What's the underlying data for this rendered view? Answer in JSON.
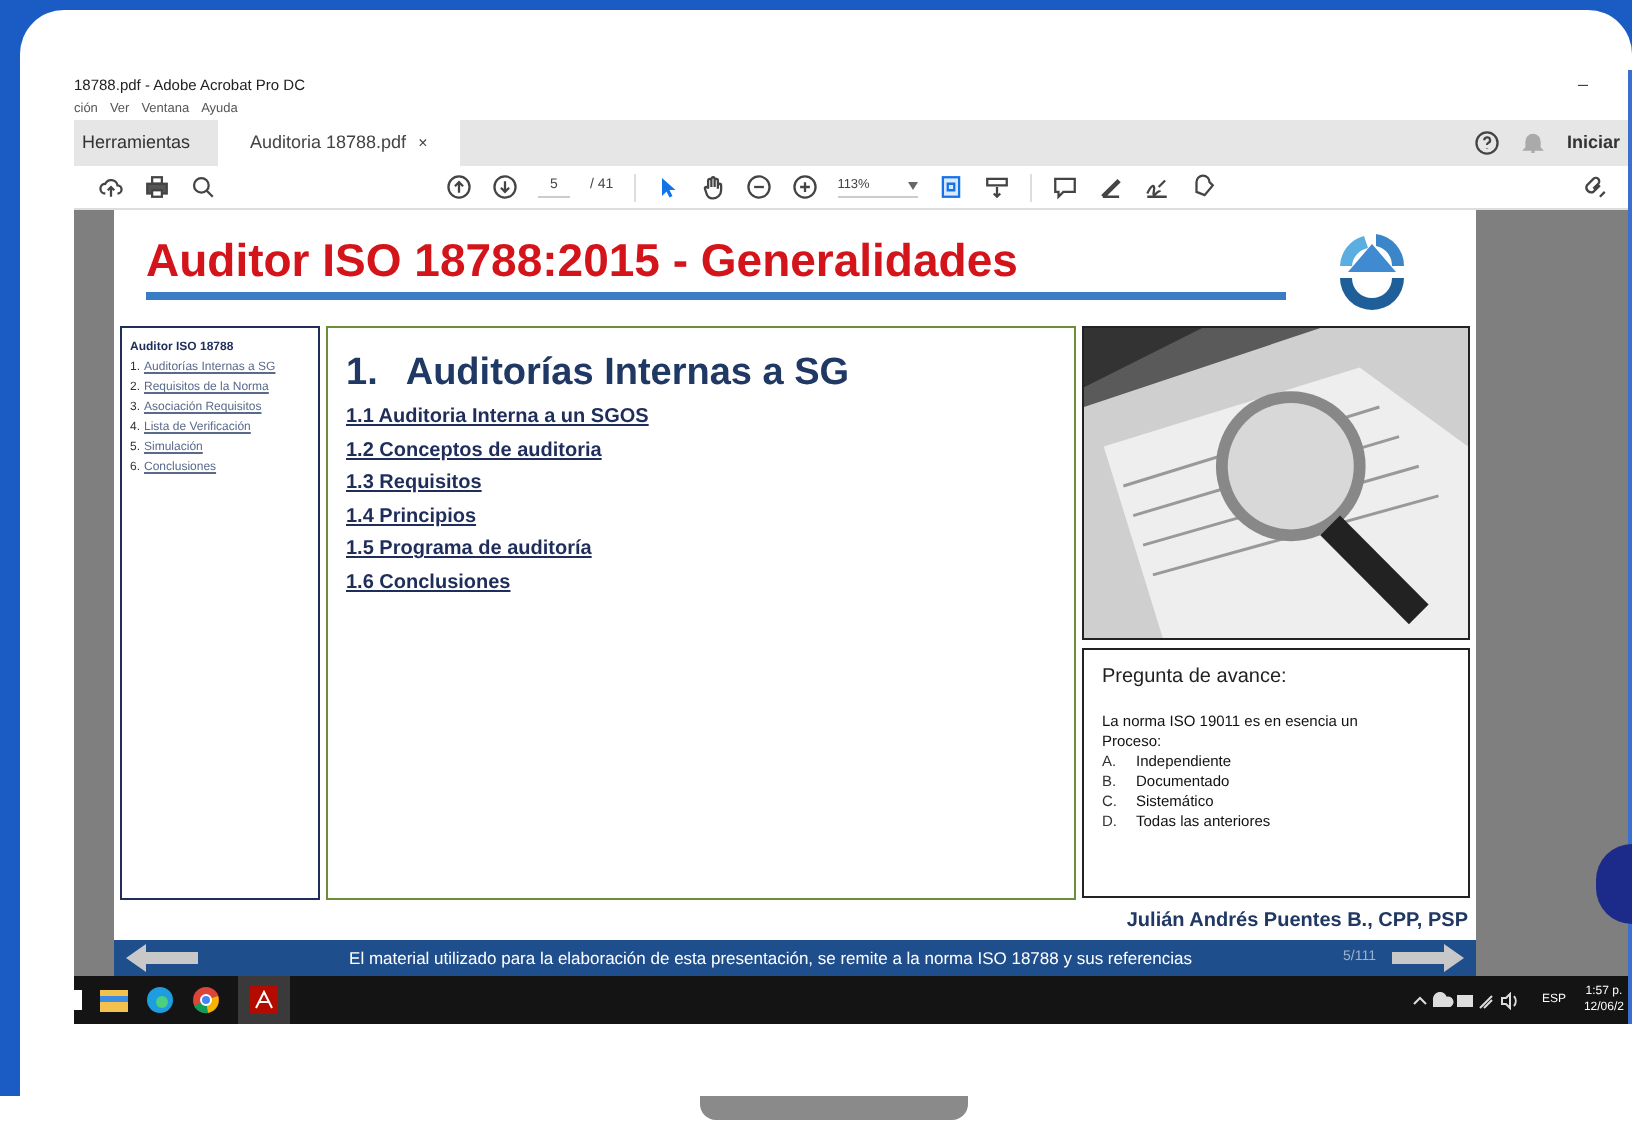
{
  "window": {
    "title": "18788.pdf - Adobe Acrobat Pro DC",
    "minimize": "–"
  },
  "menu": [
    "ción",
    "Ver",
    "Ventana",
    "Ayuda"
  ],
  "tabs": [
    {
      "label": "Herramientas",
      "selected": false
    },
    {
      "label": "Auditoria 18788.pdf",
      "selected": true,
      "close": "×"
    }
  ],
  "account": "Iniciar",
  "toolbar": {
    "page": "5",
    "pages": "/ 41",
    "zoom": "113%"
  },
  "slide": {
    "title": "Auditor ISO 18788:2015 - Generalidades",
    "outline": {
      "heading": "Auditor ISO 18788",
      "items": [
        {
          "number": "1.",
          "label": "Auditorías Internas a SG"
        },
        {
          "number": "2.",
          "label": "Requisitos de la Norma"
        },
        {
          "number": "3.",
          "label": "Asociación Requisitos"
        },
        {
          "number": "4.",
          "label": "Lista de Verificación"
        },
        {
          "number": "5.",
          "label": "Simulación"
        },
        {
          "number": "6.",
          "label": "Conclusiones"
        }
      ]
    },
    "section": {
      "number": "1.",
      "title": "Auditorías Internas a SG",
      "links": [
        "1.1 Auditoria Interna a un SGOS",
        "1.2 Conceptos de auditoria",
        "1.3 Requisitos",
        "1.4 Principios",
        "1.5 Programa de auditoría",
        "1.6 Conclusiones"
      ]
    },
    "question": {
      "heading": "Pregunta de avance:",
      "text": "La norma ISO 19011 es en esencia un Proceso:",
      "options": [
        {
          "letter": "A.",
          "label": "Independiente"
        },
        {
          "letter": "B.",
          "label": "Documentado"
        },
        {
          "letter": "C.",
          "label": "Sistemático"
        },
        {
          "letter": "D.",
          "label": "Todas las anteriores"
        }
      ]
    },
    "author": "Julián Andrés Puentes B., CPP, PSP",
    "footer": "El material utilizado para la elaboración de esta presentación, se remite a la norma ISO 18788 y sus referencias",
    "page": "5/111"
  },
  "taskbar": {
    "language": "ESP",
    "time": "1:57 p.",
    "date": "12/06/2"
  }
}
